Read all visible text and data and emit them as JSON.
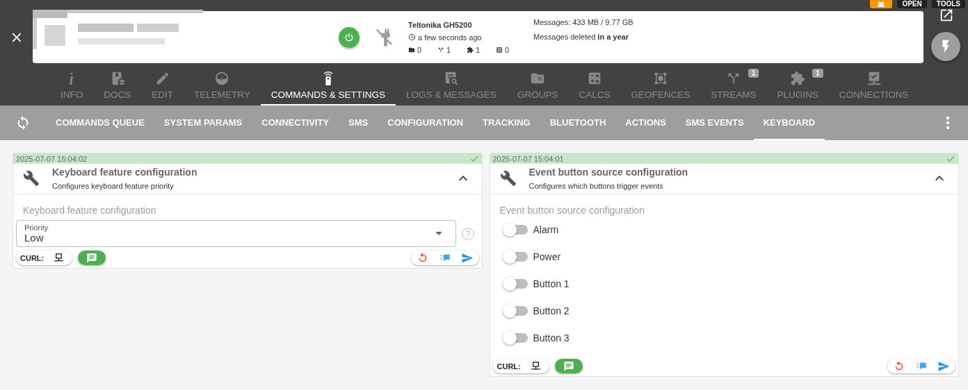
{
  "header": {
    "power_on": true,
    "device_model": "Teltonika GH5200",
    "last_seen": "a few seconds ago",
    "counters": [
      {
        "value": "0"
      },
      {
        "value": "1"
      },
      {
        "value": "1"
      },
      {
        "value": "0"
      }
    ],
    "messages_size": "Messages: 433 MB / 9.77 GB",
    "messages_retention": "Messages deleted **in a year**"
  },
  "top_buttons": [
    "OPEN",
    "TOOLS"
  ],
  "tabs": [
    {
      "label": "INFO",
      "selected": false
    },
    {
      "label": "DOCS",
      "selected": false
    },
    {
      "label": "EDIT",
      "selected": false
    },
    {
      "label": "TELEMETRY",
      "selected": false
    },
    {
      "label": "COMMANDS & SETTINGS",
      "selected": true
    },
    {
      "label": "LOGS & MESSAGES",
      "selected": false
    },
    {
      "label": "GROUPS",
      "selected": false
    },
    {
      "label": "CALCS",
      "selected": false
    },
    {
      "label": "GEOFENCES",
      "selected": false
    },
    {
      "label": "STREAMS",
      "selected": false,
      "badge": "1"
    },
    {
      "label": "PLUGINS",
      "selected": false,
      "badge": "1"
    },
    {
      "label": "CONNECTIONS",
      "selected": false
    }
  ],
  "subtabs": [
    {
      "label": "COMMANDS QUEUE",
      "selected": false
    },
    {
      "label": "SYSTEM PARAMS",
      "selected": false
    },
    {
      "label": "CONNECTIVITY",
      "selected": false
    },
    {
      "label": "SMS",
      "selected": false
    },
    {
      "label": "CONFIGURATION",
      "selected": false
    },
    {
      "label": "TRACKING",
      "selected": false
    },
    {
      "label": "BLUETOOTH",
      "selected": false
    },
    {
      "label": "ACTIONS",
      "selected": false
    },
    {
      "label": "SMS EVENTS",
      "selected": false
    },
    {
      "label": "KEYBOARD",
      "selected": true
    }
  ],
  "panels": [
    {
      "timestamp": "2025-07-07 15:04:02",
      "title": "Keyboard feature configuration",
      "subtitle": "Configures keyboard feature priority",
      "expanded": true,
      "section_label": "Keyboard feature configuration",
      "curl_label": "CURL:",
      "fields": [
        {
          "kind": "select",
          "label": "Priority",
          "value": "Low"
        }
      ]
    },
    {
      "timestamp": "2025-07-07 15:04:01",
      "title": "Event button source configuration",
      "subtitle": "Configures which buttons trigger events",
      "expanded": true,
      "section_label": "Event button source configuration",
      "curl_label": "CURL:",
      "fields": [
        {
          "kind": "toggle",
          "label": "Alarm",
          "on": false
        },
        {
          "kind": "toggle",
          "label": "Power",
          "on": false
        },
        {
          "kind": "toggle",
          "label": "Button 1",
          "on": false
        },
        {
          "kind": "toggle",
          "label": "Button 2",
          "on": false
        },
        {
          "kind": "toggle",
          "label": "Button 3",
          "on": false
        }
      ]
    }
  ]
}
